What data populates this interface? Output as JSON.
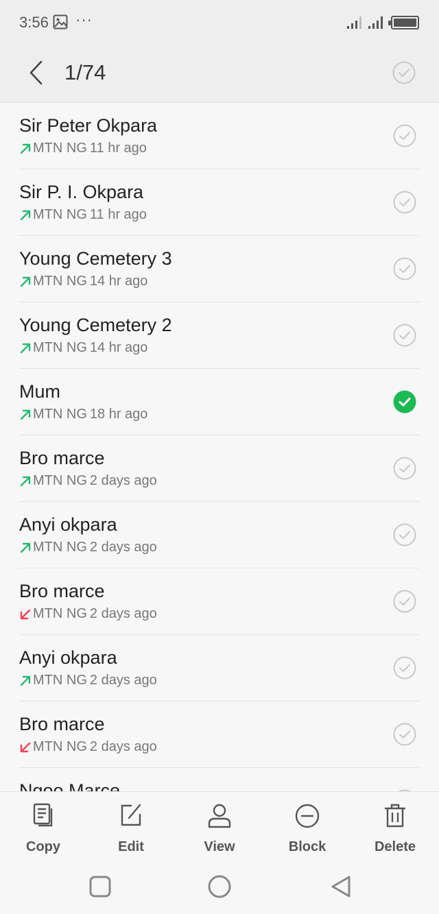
{
  "status_bar": {
    "time": "3:56",
    "icons": [
      "gallery-icon",
      "more-dots-icon",
      "signal-icon",
      "signal-icon",
      "battery-icon"
    ]
  },
  "header": {
    "counter": "1/74"
  },
  "colors": {
    "selected_green": "#1db954",
    "outgoing_green": "#2bb673",
    "incoming_red": "#f2405a",
    "check_outline": "#c8c8c8"
  },
  "calls": [
    {
      "name": "Sir Peter Okpara",
      "direction": "outgoing",
      "carrier": "MTN NG",
      "time": "11 hr ago",
      "selected": false
    },
    {
      "name": "Sir P. I. Okpara",
      "direction": "outgoing",
      "carrier": "MTN NG",
      "time": "11 hr ago",
      "selected": false
    },
    {
      "name": "Young Cemetery 3",
      "direction": "outgoing",
      "carrier": "MTN NG",
      "time": "14 hr ago",
      "selected": false
    },
    {
      "name": "Young Cemetery 2",
      "direction": "outgoing",
      "carrier": "MTN NG",
      "time": "14 hr ago",
      "selected": false
    },
    {
      "name": "Mum",
      "direction": "outgoing",
      "carrier": "MTN NG",
      "time": "18 hr ago",
      "selected": true
    },
    {
      "name": "Bro marce",
      "direction": "outgoing",
      "carrier": "MTN NG",
      "time": "2 days ago",
      "selected": false
    },
    {
      "name": "Anyi okpara",
      "direction": "outgoing",
      "carrier": "MTN NG",
      "time": "2 days ago",
      "selected": false
    },
    {
      "name": "Bro marce",
      "direction": "incoming",
      "carrier": "MTN NG",
      "time": "2 days ago",
      "selected": false
    },
    {
      "name": "Anyi okpara",
      "direction": "outgoing",
      "carrier": "MTN NG",
      "time": "2 days ago",
      "selected": false
    },
    {
      "name": "Bro marce",
      "direction": "incoming",
      "carrier": "MTN NG",
      "time": "2 days ago",
      "selected": false
    },
    {
      "name": "Ngoo Marce",
      "direction": "outgoing",
      "carrier": "",
      "time": "",
      "selected": false
    }
  ],
  "actions": {
    "copy": "Copy",
    "edit": "Edit",
    "view": "View",
    "block": "Block",
    "delete": "Delete"
  }
}
